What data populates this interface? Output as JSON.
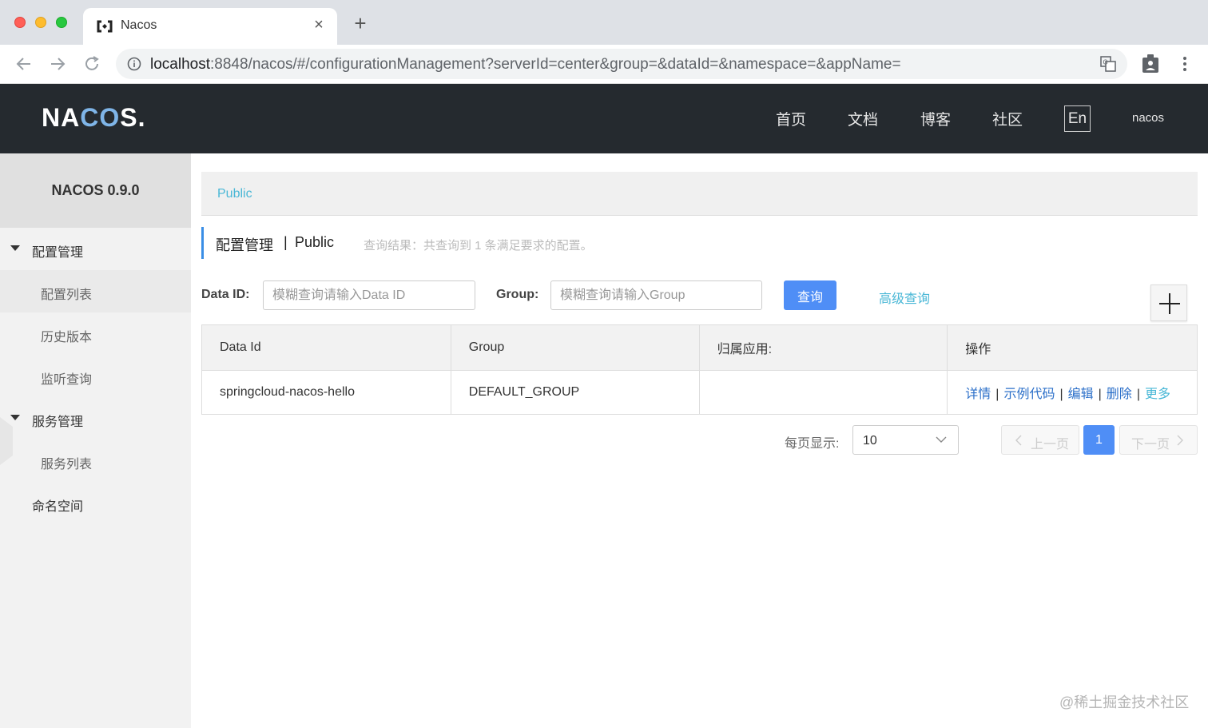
{
  "browser": {
    "tab_title": "Nacos",
    "url_host": "localhost",
    "url_rest": ":8848/nacos/#/configurationManagement?serverId=center&group=&dataId=&namespace=&appName="
  },
  "header": {
    "logo": "NACOS.",
    "nav": [
      "首页",
      "文档",
      "博客",
      "社区"
    ],
    "lang": "En",
    "user": "nacos"
  },
  "sidebar": {
    "title": "NACOS 0.9.0",
    "groups": [
      {
        "label": "配置管理",
        "items": [
          "配置列表",
          "历史版本",
          "监听查询"
        ]
      },
      {
        "label": "服务管理",
        "items": [
          "服务列表"
        ]
      }
    ],
    "namespace": "命名空间"
  },
  "main": {
    "breadcrumb": "Public",
    "title": "配置管理",
    "separator": "|",
    "namespace": "Public",
    "result": "查询结果：共查询到 1 条满足要求的配置。",
    "filters": {
      "dataid_label": "Data ID:",
      "dataid_placeholder": "模糊查询请输入Data ID",
      "group_label": "Group:",
      "group_placeholder": "模糊查询请输入Group",
      "query_label": "查询",
      "advanced_label": "高级查询"
    },
    "table": {
      "headers": [
        "Data Id",
        "Group",
        "归属应用:",
        "操作"
      ],
      "rows": [
        {
          "data_id": "springcloud-nacos-hello",
          "group": "DEFAULT_GROUP",
          "app": ""
        }
      ],
      "operations": [
        "详情",
        "示例代码",
        "编辑",
        "删除",
        "更多"
      ]
    },
    "pager": {
      "label": "每页显示:",
      "page_size": "10",
      "prev": "上一页",
      "current": "1",
      "next": "下一页"
    }
  },
  "watermark": "@稀土掘金技术社区",
  "colors": {
    "header_bg": "#252a2f",
    "primary": "#4f8ef6",
    "link": "#2b6fc9",
    "accent": "#49b7d6"
  }
}
